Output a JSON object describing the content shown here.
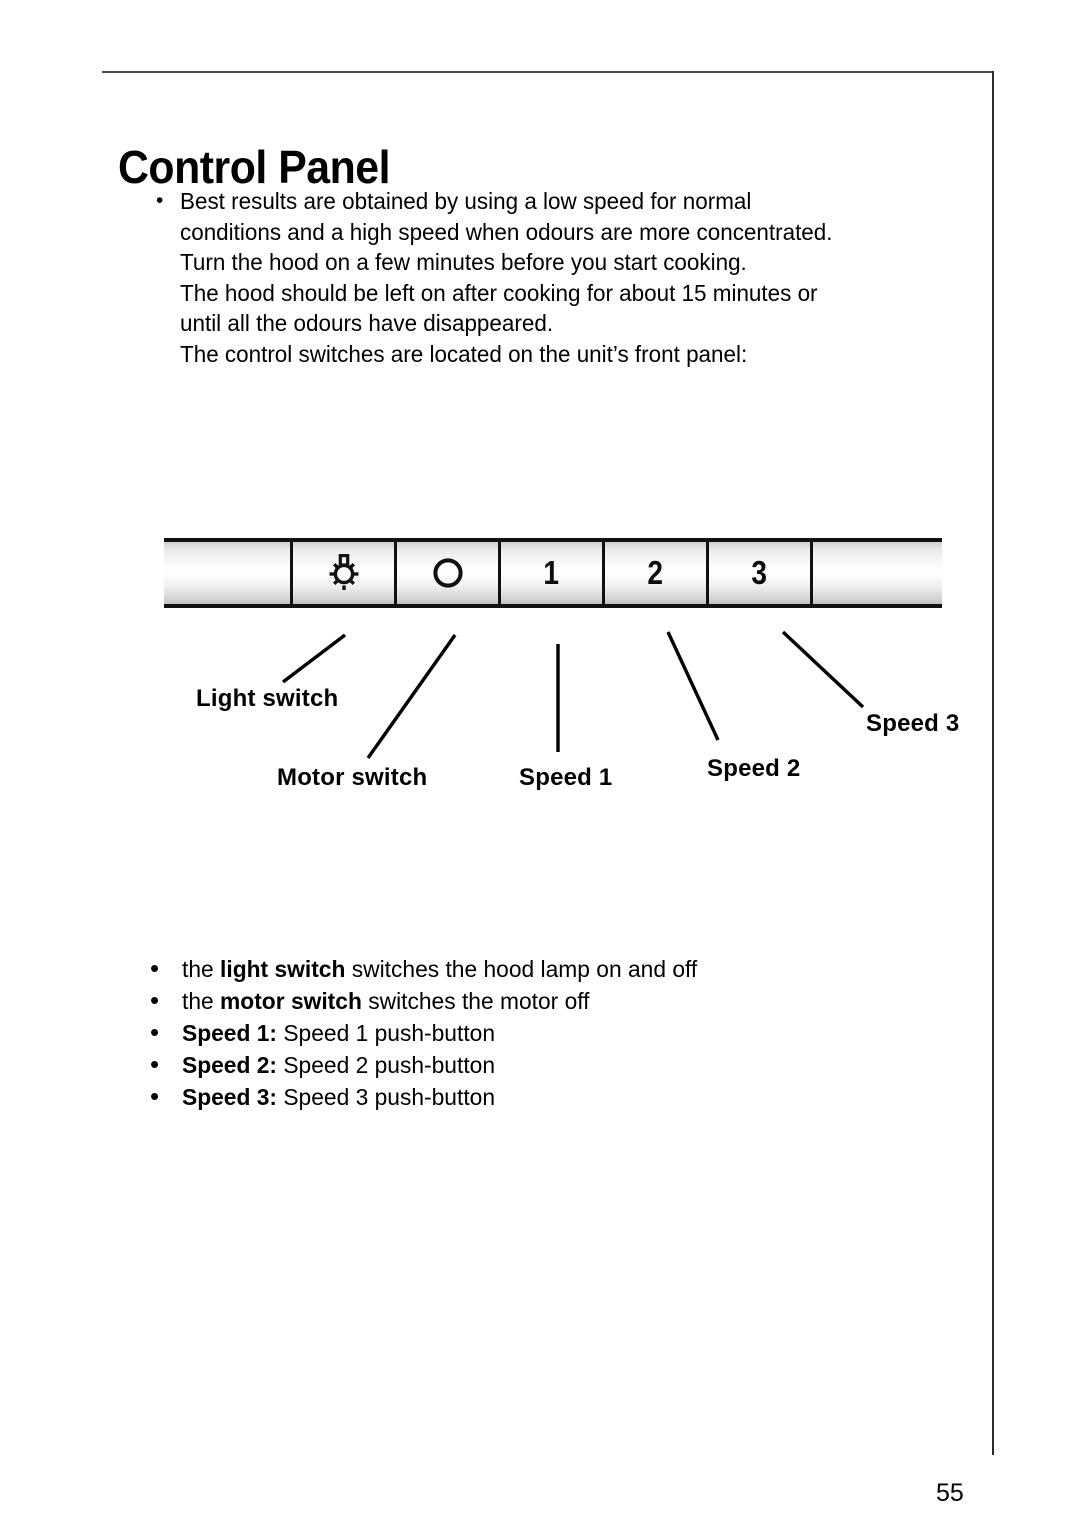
{
  "page": {
    "title": "Control Panel",
    "page_number": "55"
  },
  "intro": {
    "bullet": "•",
    "lines": [
      "Best results are obtained by using a low speed for normal",
      "conditions and a high speed when odours are more concentrated.",
      "Turn the hood on a few minutes before you start cooking.",
      "The hood should be left on after cooking for about 15 minutes or",
      "until all the odours have disappeared.",
      "The control switches are located on the unit’s front panel:"
    ]
  },
  "control_panel": {
    "buttons": [
      {
        "key": "blank_left",
        "label": "",
        "icon": ""
      },
      {
        "key": "light",
        "label": "",
        "icon": "light-bulb-icon"
      },
      {
        "key": "motor_off",
        "label": "",
        "icon": "circle-o-icon"
      },
      {
        "key": "speed1",
        "label": "1",
        "icon": ""
      },
      {
        "key": "speed2",
        "label": "2",
        "icon": ""
      },
      {
        "key": "speed3",
        "label": "3",
        "icon": ""
      },
      {
        "key": "blank_right",
        "label": "",
        "icon": ""
      }
    ],
    "callouts": {
      "light_switch": "Light  switch",
      "motor_switch": "Motor switch",
      "speed1": "Speed 1",
      "speed2": "Speed 2",
      "speed3": "Speed 3"
    }
  },
  "details": {
    "bullet": "•",
    "items": [
      {
        "prefix": "the ",
        "bold": "light switch",
        "suffix": " switches the hood lamp on and off"
      },
      {
        "prefix": "the ",
        "bold": "motor switch",
        "suffix": " switches the motor off"
      },
      {
        "prefix": "",
        "bold": "Speed 1:",
        "suffix": " Speed 1 push-button"
      },
      {
        "prefix": "",
        "bold": "Speed 2:",
        "suffix": " Speed 2 push-button"
      },
      {
        "prefix": "",
        "bold": "Speed 3:",
        "suffix": " Speed 3 push-button"
      }
    ]
  },
  "colors": {
    "ink": "#000000",
    "frame": "#2b2b2b",
    "panel_outline": "#111111",
    "paper": "#ffffff"
  }
}
